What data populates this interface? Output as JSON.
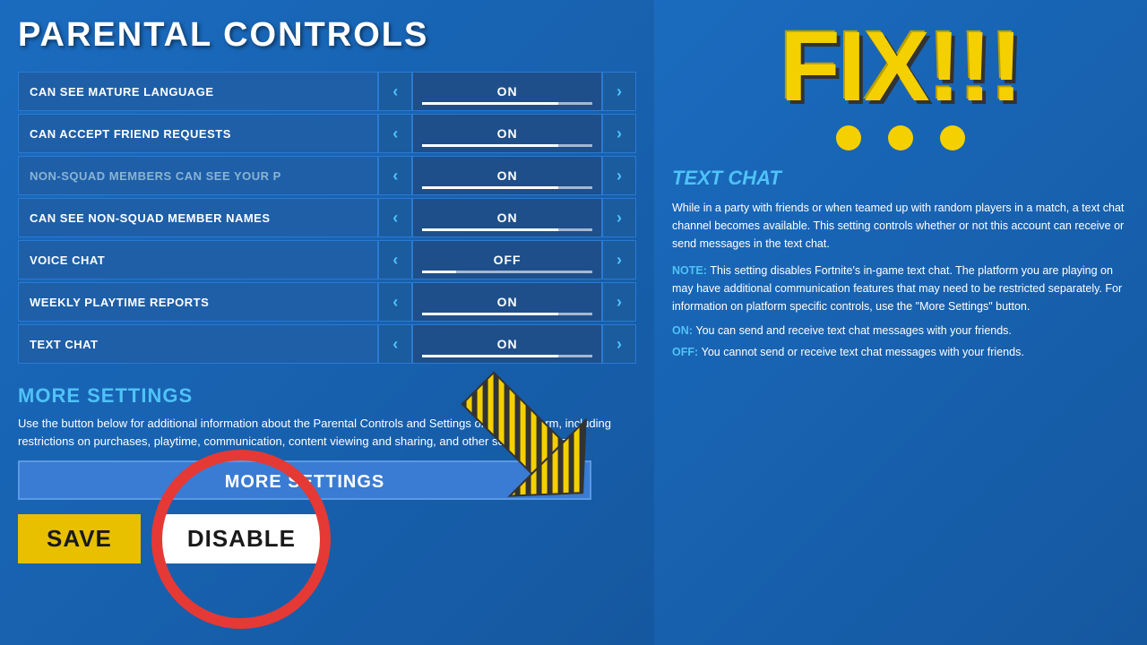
{
  "page": {
    "title": "PARENTAL CONTROLS",
    "settings": [
      {
        "label": "CAN SEE MATURE LANGUAGE",
        "value": "ON",
        "dimmed": false
      },
      {
        "label": "CAN ACCEPT FRIEND REQUESTS",
        "value": "ON",
        "dimmed": false
      },
      {
        "label": "NON-SQUAD MEMBERS CAN SEE YOUR P",
        "value": "ON",
        "dimmed": true
      },
      {
        "label": "CAN SEE NON-SQUAD MEMBER NAMES",
        "value": "ON",
        "dimmed": false
      },
      {
        "label": "VOICE CHAT",
        "value": "OFF",
        "dimmed": false
      },
      {
        "label": "WEEKLY PLAYTIME REPORTS",
        "value": "ON",
        "dimmed": false
      },
      {
        "label": "TEXT CHAT",
        "value": "ON",
        "dimmed": false
      }
    ],
    "more_settings_title": "MORE SETTINGS",
    "more_settings_text": "Use the button below for additional information about the Parental Controls and Settings on your platform, including restrictions on purchases, playtime, communication, content viewing and sharing, and other social features.",
    "more_settings_button": "MORE SETTINGS",
    "save_button": "SAVE",
    "disable_button": "DISABLE"
  },
  "right_panel": {
    "fix_title": "FIX!!!",
    "text_chat_title": "TEXT CHAT",
    "description": "While in a party with friends or when teamed up with random players in a match, a text chat channel becomes available. This setting controls whether or not this account can receive or send messages in the text chat.",
    "note": "This setting disables Fortnite's in-game text chat. The platform you are playing on may have additional communication features that may need to be restricted separately. For information on platform specific controls, use the \"More Settings\" button.",
    "on_text": "You can send and receive text chat messages with your friends.",
    "off_text": "You cannot send or receive text chat messages with your friends."
  }
}
